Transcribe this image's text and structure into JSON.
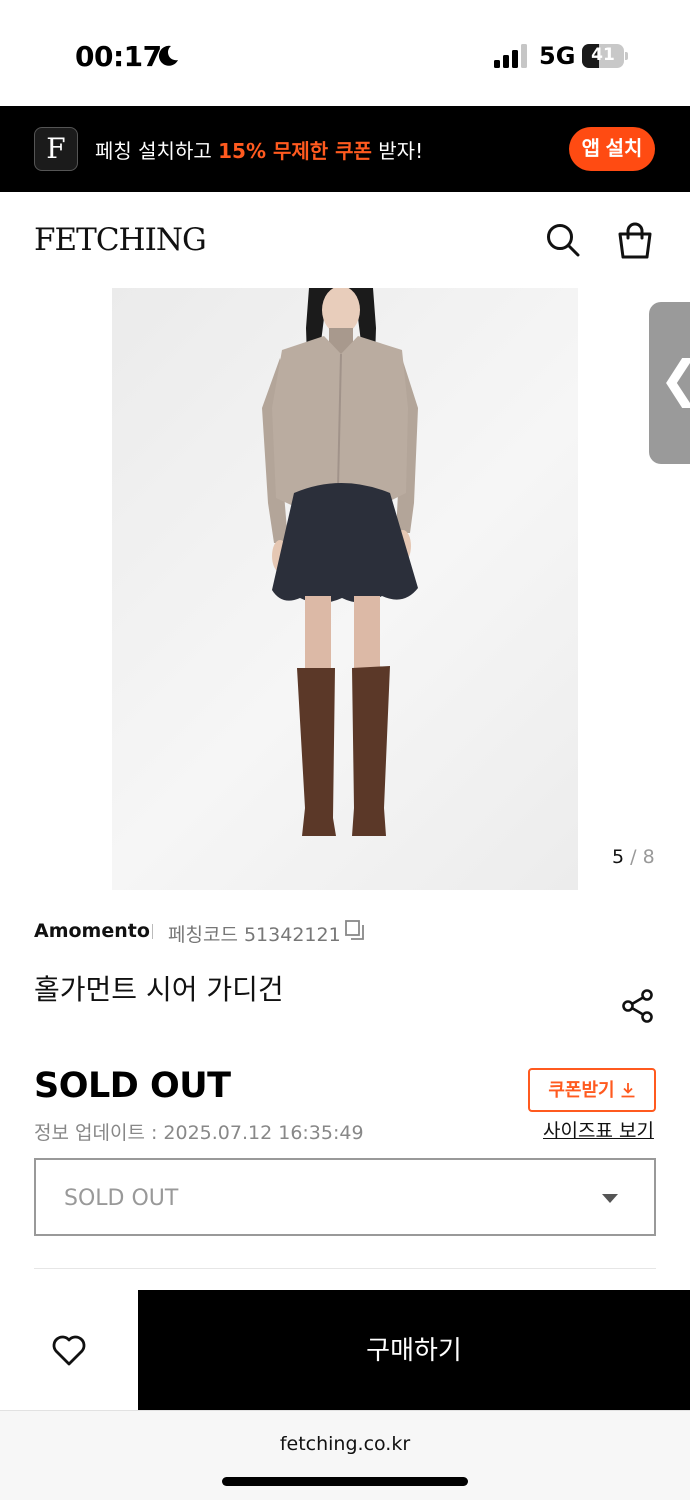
{
  "status_bar": {
    "time": "00:17",
    "network": "5G",
    "battery_level": "41",
    "battery_fraction": 0.41
  },
  "promo_banner": {
    "logo_letter": "F",
    "text_before": "페칭 설치하고 ",
    "text_highlight": "15% 무제한 쿠폰",
    "text_after": " 받자!",
    "install_label": "앱 설치",
    "accent_color": "#ff4b12"
  },
  "header": {
    "logo": "FETCHING",
    "icons": [
      "search-icon",
      "shopping-bag-icon"
    ]
  },
  "gallery": {
    "current": "5",
    "separator": " / ",
    "total": "8",
    "side_tab_icon": "chevron-left-icon"
  },
  "product": {
    "brand": "Amomento",
    "code_label": "페칭코드 51342121",
    "name": "홀가먼트 시어 가디건",
    "price": "SOLD OUT",
    "update_info": "정보 업데이트 : 2025.07.12 16:35:49",
    "coupon_label": "쿠폰받기",
    "size_chart_label": "사이즈표 보기",
    "option_value": "SOLD OUT"
  },
  "actions": {
    "buy_label": "구매하기",
    "wish_icon": "heart-icon"
  },
  "browser": {
    "url": "fetching.co.kr"
  }
}
